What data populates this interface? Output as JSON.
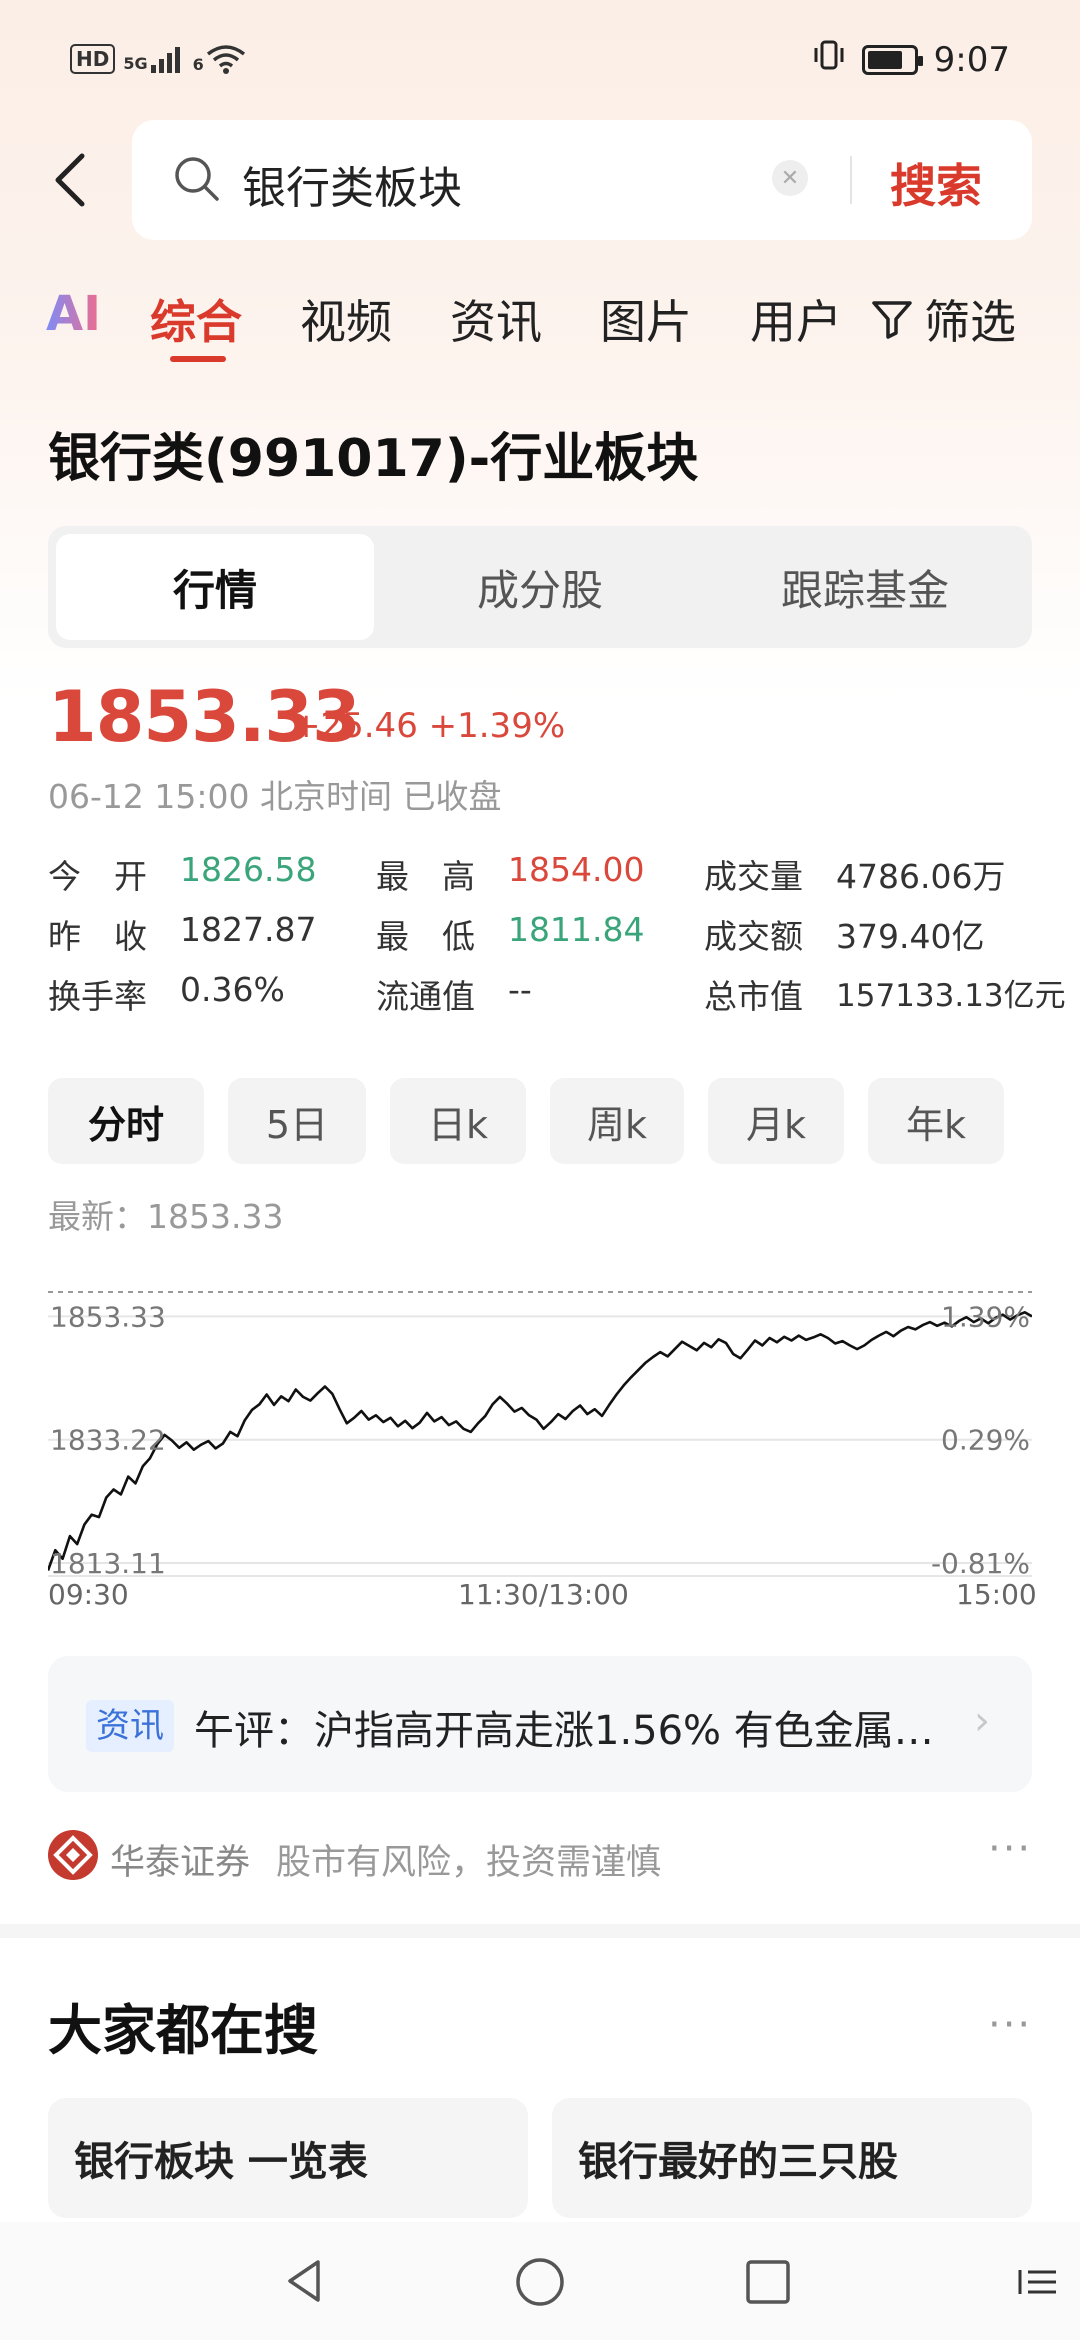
{
  "status_bar": {
    "network_badge": "HD",
    "signal_label": "5G",
    "wifi_label": "6",
    "time": "9:07",
    "battery_level": 0.78
  },
  "search": {
    "query": "银行类板块",
    "submit_label": "搜索"
  },
  "tabs": [
    {
      "label": "AI"
    },
    {
      "label": "综合"
    },
    {
      "label": "视频"
    },
    {
      "label": "资讯"
    },
    {
      "label": "图片"
    },
    {
      "label": "用户"
    },
    {
      "label": "筛选"
    }
  ],
  "sector": {
    "title": "银行类(991017)-行业板块"
  },
  "segments": [
    {
      "label": "行情"
    },
    {
      "label": "成分股"
    },
    {
      "label": "跟踪基金"
    }
  ],
  "quote": {
    "price": "1853.33",
    "change": "+25.46 +1.39%",
    "time_status": "06-12 15:00 北京时间 已收盘",
    "stats": {
      "open_label": "今　开",
      "open_value": "1826.58",
      "high_label": "最　高",
      "high_value": "1854.00",
      "volume_label": "成交量",
      "volume_value": "4786.06万",
      "prev_close_label": "昨　收",
      "prev_close_value": "1827.87",
      "low_label": "最　低",
      "low_value": "1811.84",
      "turnover_label": "成交额",
      "turnover_value": "379.40亿",
      "turnover_rate_label": "换手率",
      "turnover_rate_value": "0.36%",
      "float_cap_label": "流通值",
      "float_cap_value": "--",
      "market_cap_label": "总市值",
      "market_cap_value": "157133.13亿元"
    }
  },
  "periods": [
    {
      "label": "分时"
    },
    {
      "label": "5日"
    },
    {
      "label": "日k"
    },
    {
      "label": "周k"
    },
    {
      "label": "月k"
    },
    {
      "label": "年k"
    }
  ],
  "latest_label": "最新：1853.33",
  "chart_data": {
    "type": "line",
    "y_left_ticks": [
      "1853.33",
      "1833.22",
      "1813.11"
    ],
    "y_right_ticks": [
      "1.39%",
      "0.29%",
      "-0.81%"
    ],
    "x_ticks": [
      "09:30",
      "11:30/13:00",
      "15:00"
    ],
    "ylim": [
      1811.0,
      1856.0
    ],
    "reference_line": 1853.33,
    "grid": true,
    "series": [
      {
        "values": [
          1811.9,
          1815.2,
          1813.8,
          1817.5,
          1816.2,
          1819.4,
          1821.0,
          1820.6,
          1823.8,
          1825.1,
          1824.3,
          1827.2,
          1826.1,
          1828.9,
          1830.2,
          1832.5,
          1834.0,
          1833.1,
          1831.9,
          1832.8,
          1831.6,
          1832.4,
          1833.0,
          1831.8,
          1832.6,
          1834.5,
          1833.8,
          1836.4,
          1838.1,
          1839.0,
          1840.6,
          1838.9,
          1840.3,
          1839.5,
          1841.4,
          1840.2,
          1839.6,
          1840.8,
          1841.9,
          1840.7,
          1838.2,
          1835.9,
          1836.8,
          1837.9,
          1836.5,
          1837.2,
          1836.1,
          1836.8,
          1835.4,
          1836.3,
          1835.1,
          1836.0,
          1837.6,
          1836.2,
          1836.9,
          1835.6,
          1836.2,
          1835.0,
          1834.5,
          1835.9,
          1837.1,
          1839.0,
          1840.2,
          1839.1,
          1837.8,
          1838.4,
          1837.2,
          1836.5,
          1835.0,
          1836.1,
          1837.4,
          1836.6,
          1837.9,
          1838.8,
          1837.4,
          1838.2,
          1837.1,
          1838.9,
          1840.6,
          1842.1,
          1843.4,
          1844.6,
          1845.8,
          1846.7,
          1847.5,
          1846.8,
          1848.0,
          1849.2,
          1848.5,
          1847.8,
          1849.0,
          1848.3,
          1849.6,
          1849.0,
          1847.2,
          1846.5,
          1847.9,
          1849.4,
          1848.6,
          1849.8,
          1849.1,
          1850.0,
          1849.4,
          1850.2,
          1849.5,
          1849.9,
          1850.4,
          1849.8,
          1848.9,
          1849.3,
          1848.6,
          1848.0,
          1848.6,
          1849.5,
          1850.2,
          1850.8,
          1850.1,
          1851.0,
          1851.6,
          1851.2,
          1851.9,
          1852.4,
          1851.8,
          1852.3,
          1851.7,
          1852.6,
          1853.2,
          1852.4,
          1853.0,
          1852.2,
          1853.1,
          1853.6,
          1852.8,
          1853.5,
          1854.0,
          1853.33
        ]
      }
    ]
  },
  "news": {
    "tag": "资讯",
    "text": "午评：沪指高开高走涨1.56% 有色金属…"
  },
  "broker": {
    "name": "华泰证券",
    "disclaimer": "股市有风险，投资需谨慎"
  },
  "popular": {
    "title": "大家都在搜",
    "items": [
      {
        "label": "银行板块 一览表"
      },
      {
        "label": "银行最好的三只股"
      }
    ]
  },
  "colors": {
    "accent": "#d93a2c",
    "up": "#d9483b",
    "down": "#3aa57a"
  }
}
